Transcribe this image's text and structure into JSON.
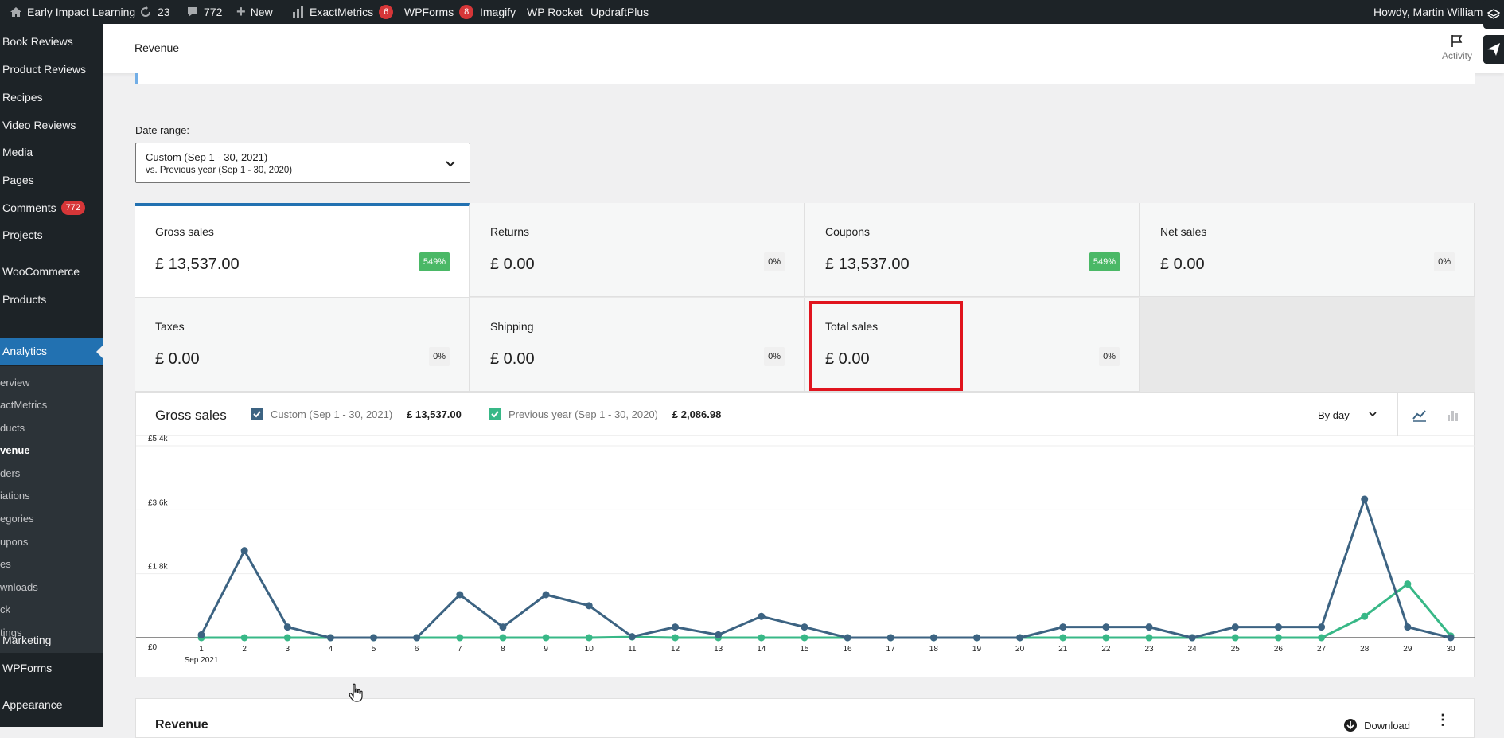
{
  "adminbar": {
    "site_name": "Early Impact Learning",
    "updates": "23",
    "comments": "772",
    "new_label": "New",
    "exactmetrics": "ExactMetrics",
    "exactmetrics_badge": "6",
    "wpforms": "WPForms",
    "wpforms_badge": "8",
    "imagify": "Imagify",
    "wp_rocket": "WP Rocket",
    "updraftplus": "UpdraftPlus",
    "howdy": "Howdy, Martin Williams"
  },
  "sidebar": {
    "items": [
      {
        "label": "Book Reviews"
      },
      {
        "label": "Product Reviews"
      },
      {
        "label": "Recipes"
      },
      {
        "label": "Video Reviews"
      },
      {
        "label": "Media"
      },
      {
        "label": "Pages"
      },
      {
        "label": "Comments",
        "badge": "772"
      },
      {
        "label": "Projects"
      },
      {
        "label": "WooCommerce"
      },
      {
        "label": "Products"
      },
      {
        "label": "Analytics"
      },
      {
        "label": "Marketing"
      },
      {
        "label": "WPForms"
      },
      {
        "label": "Appearance"
      }
    ],
    "subitems": [
      "erview",
      "actMetrics",
      "ducts",
      "venue",
      "ders",
      "iations",
      "egories",
      "upons",
      "es",
      "wnloads",
      "ck",
      "tings"
    ]
  },
  "header": {
    "title": "Revenue",
    "activity_label": "Activity"
  },
  "date_range": {
    "label": "Date range:",
    "primary": "Custom (Sep 1 - 30, 2021)",
    "secondary": "vs. Previous year (Sep 1 - 30, 2020)"
  },
  "summary": [
    {
      "label": "Gross sales",
      "value": "£ 13,537.00",
      "delta": "549%"
    },
    {
      "label": "Returns",
      "value": "£ 0.00",
      "delta": "0%"
    },
    {
      "label": "Coupons",
      "value": "£ 13,537.00",
      "delta": "549%"
    },
    {
      "label": "Net sales",
      "value": "£ 0.00",
      "delta": "0%"
    },
    {
      "label": "Taxes",
      "value": "£ 0.00",
      "delta": "0%"
    },
    {
      "label": "Shipping",
      "value": "£ 0.00",
      "delta": "0%"
    },
    {
      "label": "Total sales",
      "value": "£ 0.00",
      "delta": "0%"
    }
  ],
  "chart_panel": {
    "title": "Gross sales",
    "legend": [
      {
        "label": "Custom (Sep 1 - 30, 2021)",
        "total": "£ 13,537.00"
      },
      {
        "label": "Previous year (Sep 1 - 30, 2020)",
        "total": "£ 2,086.98"
      }
    ],
    "interval": "By day",
    "month_label": "Sep 2021"
  },
  "chart_data": {
    "type": "line",
    "title": "Gross sales",
    "xlabel": "",
    "ylabel": "",
    "x": [
      1,
      2,
      3,
      4,
      5,
      6,
      7,
      8,
      9,
      10,
      11,
      12,
      13,
      14,
      15,
      16,
      17,
      18,
      19,
      20,
      21,
      22,
      23,
      24,
      25,
      26,
      27,
      28,
      29,
      30
    ],
    "y_ticks": [
      "£0",
      "£1.8k",
      "£3.6k",
      "£5.4k"
    ],
    "ylim": [
      0,
      5400
    ],
    "grid": true,
    "series": [
      {
        "name": "Custom (Sep 1 - 30, 2021)",
        "color": "#3c6382",
        "values": [
          80,
          2450,
          300,
          0,
          0,
          0,
          1210,
          300,
          1210,
          900,
          30,
          300,
          80,
          600,
          300,
          0,
          0,
          0,
          0,
          0,
          300,
          300,
          300,
          0,
          300,
          300,
          300,
          3900,
          300,
          0
        ]
      },
      {
        "name": "Previous year (Sep 1 - 30, 2020)",
        "color": "#38b887",
        "values": [
          0,
          0,
          0,
          0,
          0,
          0,
          0,
          0,
          0,
          0,
          20,
          0,
          0,
          0,
          0,
          0,
          0,
          0,
          0,
          0,
          0,
          0,
          0,
          0,
          0,
          0,
          0,
          600,
          1510,
          50
        ]
      }
    ]
  },
  "table_panel": {
    "title": "Revenue",
    "download_label": "Download"
  },
  "colors": {
    "accent": "#2271b1",
    "highlight_box": "#e0141e",
    "positive_badge": "#4ab866"
  }
}
